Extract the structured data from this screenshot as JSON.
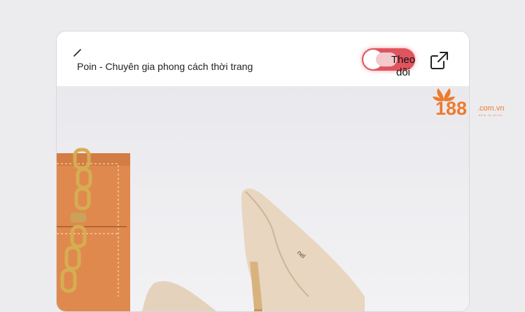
{
  "header": {
    "title": "Poin - Chuyên gia phong cách thời trang",
    "follow_label": "Theo dõi",
    "back_icon": "back-arrow-icon",
    "share_icon": "share-icon"
  },
  "watermark": {
    "text_main": "188",
    "text_domain": ".com.vn",
    "tagline": "đem là thích"
  },
  "colors": {
    "follow_accent": "#e0545f",
    "logo_orange": "#ee7a2c"
  }
}
